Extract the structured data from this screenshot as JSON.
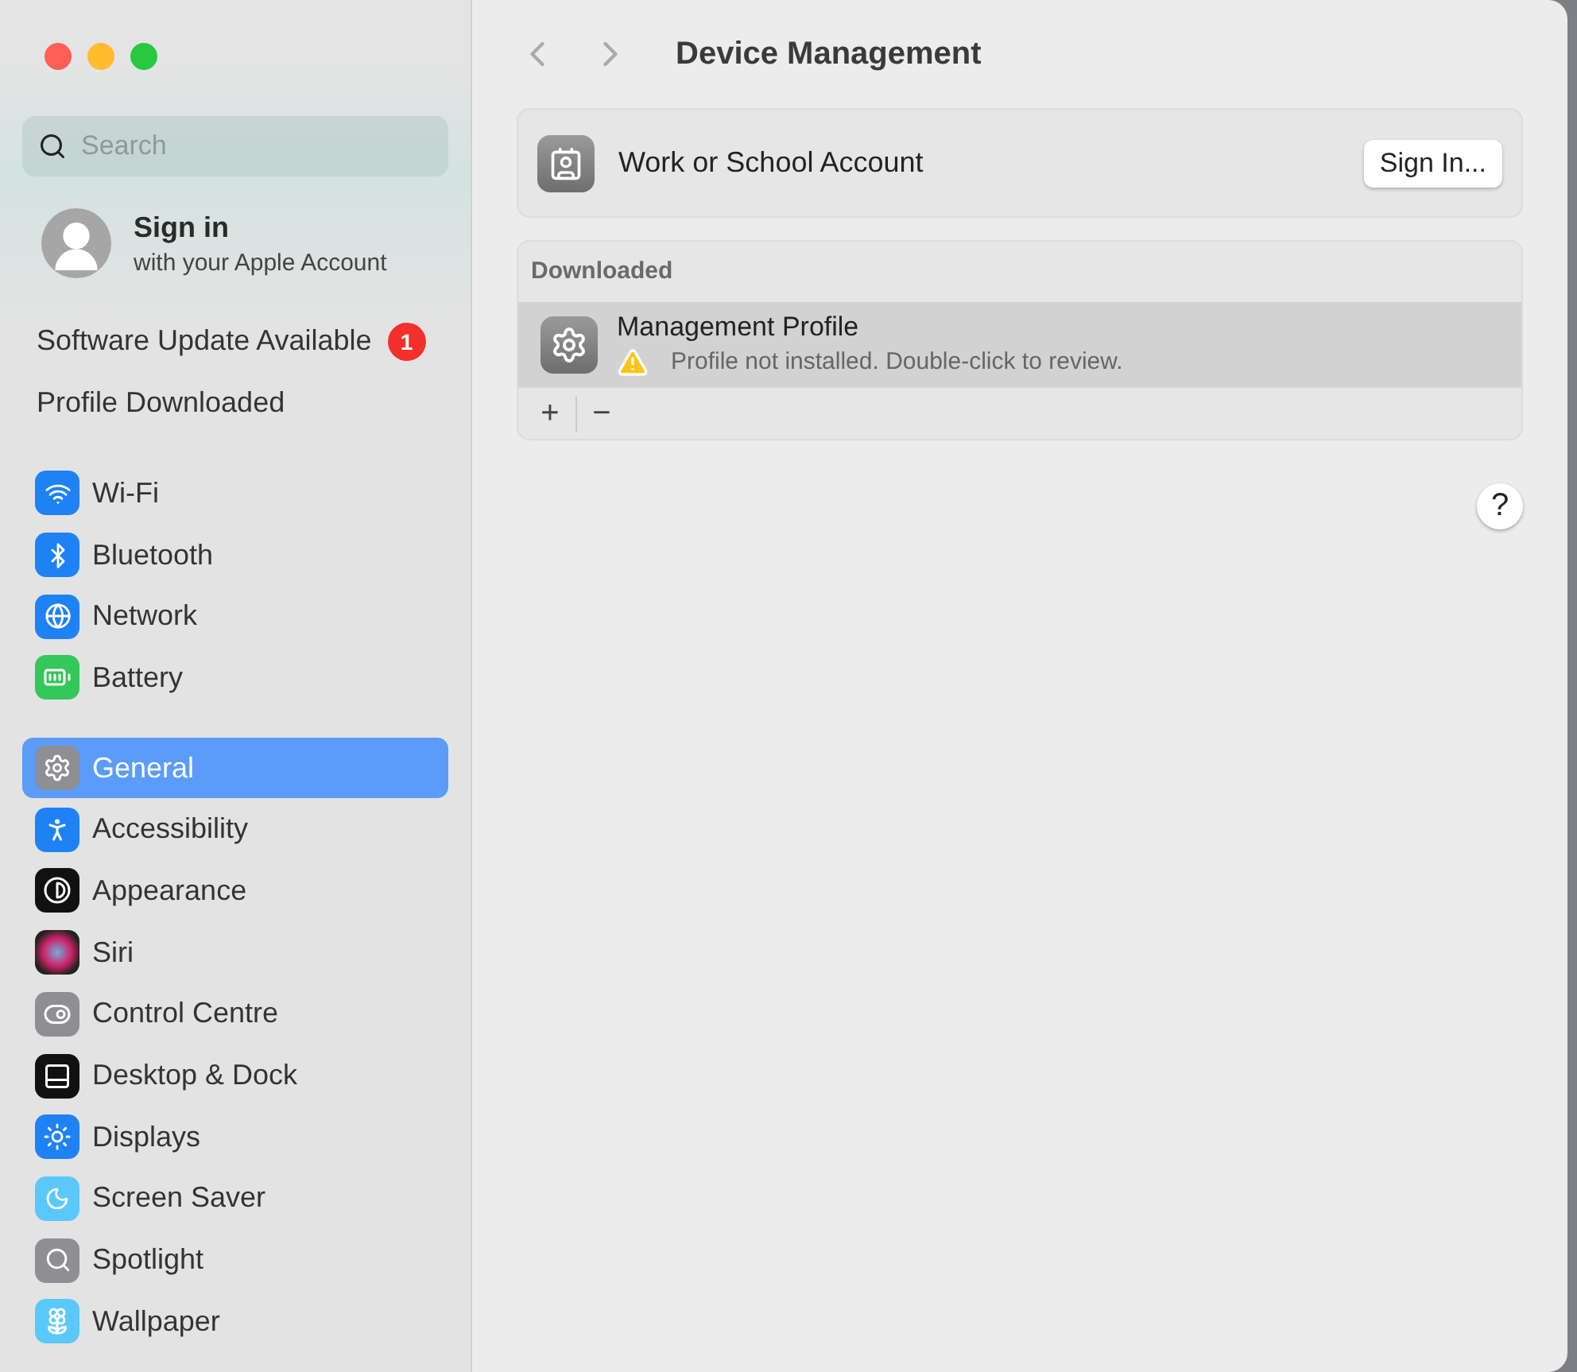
{
  "sidebar": {
    "search": {
      "placeholder": "Search"
    },
    "account": {
      "title": "Sign in",
      "subtitle": "with your Apple Account"
    },
    "notices": [
      {
        "label": "Software Update Available",
        "badge": "1"
      },
      {
        "label": "Profile Downloaded"
      }
    ],
    "groups": [
      [
        {
          "label": "Wi-Fi",
          "kind": "wifi",
          "selected": false
        },
        {
          "label": "Bluetooth",
          "kind": "bluetooth",
          "selected": false
        },
        {
          "label": "Network",
          "kind": "network",
          "selected": false
        },
        {
          "label": "Battery",
          "kind": "battery",
          "selected": false
        }
      ],
      [
        {
          "label": "General",
          "kind": "general",
          "selected": true
        },
        {
          "label": "Accessibility",
          "kind": "accessibility",
          "selected": false
        },
        {
          "label": "Appearance",
          "kind": "appearance",
          "selected": false
        },
        {
          "label": "Siri",
          "kind": "siri",
          "selected": false
        },
        {
          "label": "Control Centre",
          "kind": "control",
          "selected": false
        },
        {
          "label": "Desktop & Dock",
          "kind": "dock",
          "selected": false
        },
        {
          "label": "Displays",
          "kind": "displays",
          "selected": false
        },
        {
          "label": "Screen Saver",
          "kind": "screensaver",
          "selected": false
        },
        {
          "label": "Spotlight",
          "kind": "spotlight",
          "selected": false
        },
        {
          "label": "Wallpaper",
          "kind": "wallpaper",
          "selected": false
        }
      ]
    ]
  },
  "main": {
    "title": "Device Management",
    "account_row": {
      "label": "Work or School Account",
      "button": "Sign In..."
    },
    "downloaded": {
      "header": "Downloaded",
      "profiles": [
        {
          "name": "Management Profile",
          "status": "Profile not installed. Double-click to review.",
          "selected": true
        }
      ],
      "add": "+",
      "remove": "−"
    },
    "help": "?"
  }
}
